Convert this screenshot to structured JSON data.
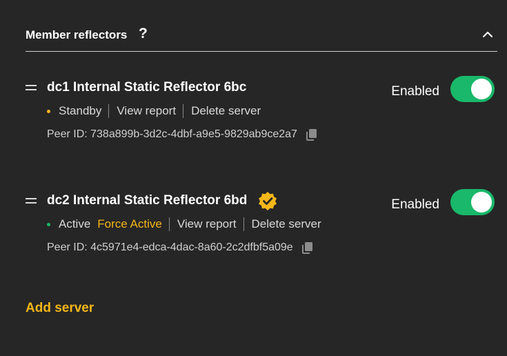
{
  "section": {
    "title": "Member reflectors",
    "help_label": "?"
  },
  "servers": [
    {
      "name": "dc1 Internal Static Reflector 6bc",
      "verified": false,
      "enabled_label": "Enabled",
      "enabled": true,
      "status": "Standby",
      "status_color": "#f5b71a",
      "view_report": "View report",
      "delete_server": "Delete server",
      "peer_id": "Peer ID: 738a899b-3d2c-4dbf-a9e5-9829ab9ce2a7"
    },
    {
      "name": "dc2 Internal Static Reflector 6bd",
      "verified": true,
      "enabled_label": "Enabled",
      "enabled": true,
      "status": "Active",
      "status_color": "#19b86a",
      "force_active": "Force Active",
      "view_report": "View report",
      "delete_server": "Delete server",
      "peer_id": "Peer ID: 4c5971e4-edca-4dac-8a60-2c2dfbf5a09e"
    }
  ],
  "add_server_label": "Add server",
  "colors": {
    "accent": "#f5b71a",
    "toggle_on": "#19b86a",
    "background": "#262626"
  },
  "icons": [
    "help-icon",
    "chevron-up-icon",
    "drag-handle-icon",
    "verified-badge-icon",
    "copy-icon"
  ]
}
